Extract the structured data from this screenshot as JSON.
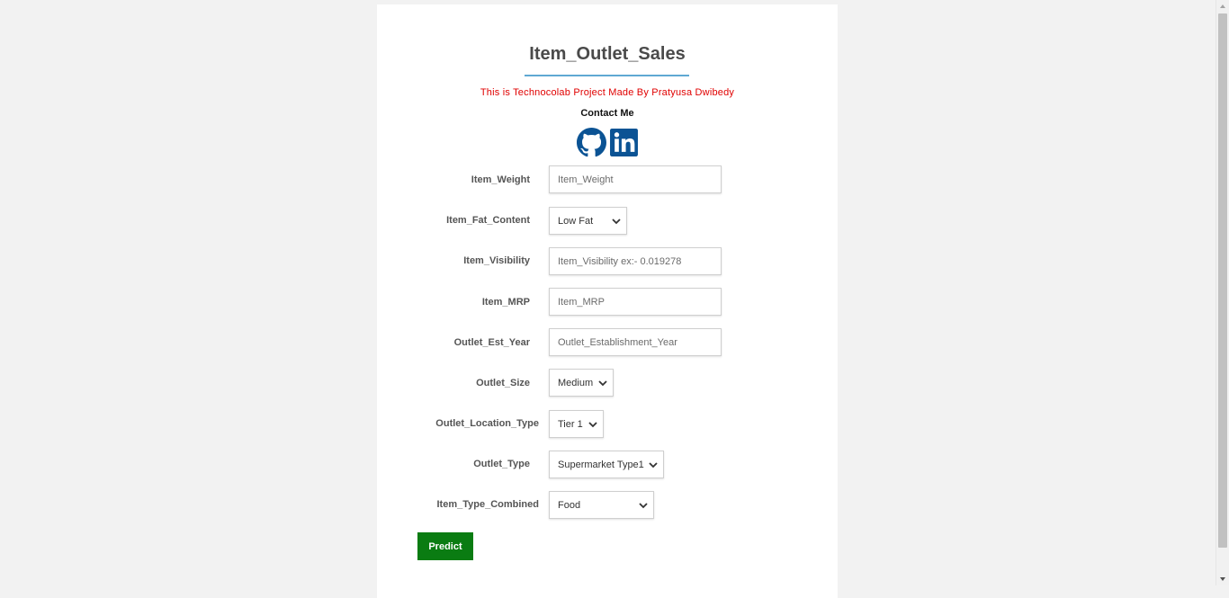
{
  "header": {
    "title": "Item_Outlet_Sales",
    "subtitle": "This is Technocolab Project Made By Pratyusa Dwibedy",
    "contact_label": "Contact Me"
  },
  "social": {
    "github_icon": "github-icon",
    "linkedin_icon": "linkedin-icon",
    "brand_color": "#0b5394"
  },
  "form": {
    "item_weight": {
      "label": "Item_Weight",
      "placeholder": "Item_Weight",
      "value": ""
    },
    "item_fat_content": {
      "label": "Item_Fat_Content",
      "selected": "Low Fat"
    },
    "item_visibility": {
      "label": "Item_Visibility",
      "placeholder": "Item_Visibility ex:- 0.019278",
      "value": ""
    },
    "item_mrp": {
      "label": "Item_MRP",
      "placeholder": "Item_MRP",
      "value": ""
    },
    "outlet_est_year": {
      "label": "Outlet_Est_Year",
      "placeholder": "Outlet_Establishment_Year",
      "value": ""
    },
    "outlet_size": {
      "label": "Outlet_Size",
      "selected": "Medium"
    },
    "outlet_location_type": {
      "label": "Outlet_Location_Type",
      "selected": "Tier 1"
    },
    "outlet_type": {
      "label": "Outlet_Type",
      "selected": "Supermarket Type1"
    },
    "item_type_combined": {
      "label": "Item_Type_Combined",
      "selected": "Food"
    },
    "predict_label": "Predict"
  },
  "colors": {
    "subtitle": "#e00000",
    "predict_button": "#0a7c12",
    "title_underline": "#5fa8d3"
  }
}
